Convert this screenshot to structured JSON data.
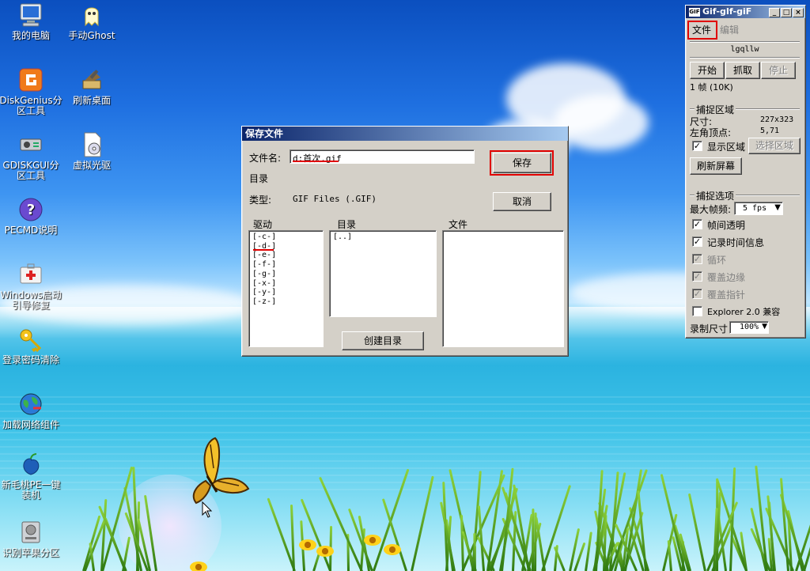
{
  "desktop_icons": [
    {
      "label": "我的电脑",
      "icon": "computer-icon"
    },
    {
      "label": "手动Ghost",
      "icon": "ghost-icon"
    },
    {
      "label": "DiskGenius分区工具",
      "icon": "diskgenius-icon"
    },
    {
      "label": "刷新桌面",
      "icon": "refresh-desktop-icon"
    },
    {
      "label": "GDISKGUI分区工具",
      "icon": "gdisk-icon"
    },
    {
      "label": "虚拟光驱",
      "icon": "virtual-drive-icon"
    },
    {
      "label": "PECMD说明",
      "icon": "help-icon"
    },
    {
      "label": "Windows启动引导修复",
      "icon": "boot-repair-icon"
    },
    {
      "label": "登录密码清除",
      "icon": "key-icon"
    },
    {
      "label": "加载网络组件",
      "icon": "network-icon"
    },
    {
      "label": "新毛桃PE一键装机",
      "icon": "peach-icon"
    },
    {
      "label": "识别苹果分区",
      "icon": "apple-partition-icon"
    }
  ],
  "save_dialog": {
    "title": "保存文件",
    "filename_label": "文件名:",
    "filename_value": "d:首次.gif",
    "dir_label": "目录",
    "type_label": "类型:",
    "type_value": "GIF Files (.GIF)",
    "save_button": "保存",
    "cancel_button": "取消",
    "drives_header": "驱动",
    "dirs_header": "目录",
    "files_header": "文件",
    "drives": [
      "[-c-]",
      "[-d-]",
      "[-e-]",
      "[-f-]",
      "[-g-]",
      "[-x-]",
      "[-y-]",
      "[-z-]"
    ],
    "dirs": [
      "[..]"
    ],
    "files": [],
    "create_dir_button": "创建目录"
  },
  "gif_window": {
    "title": "Gif-gIf-giF",
    "menu": [
      "文件",
      "编辑"
    ],
    "filename": "lgqllw",
    "start_button": "开始",
    "grab_button": "抓取",
    "stop_button": "停止",
    "frame_info": "1 帧 (10K)",
    "capture_area_title": "捕捉区域",
    "size_label": "尺寸:",
    "size_value": "227x323",
    "corner_label": "左角顶点:",
    "corner_value": "5,71",
    "show_area_label": "显示区域",
    "select_area_button": "选择区域",
    "refresh_screen_button": "刷新屏幕",
    "capture_options_title": "捕捉选项",
    "max_fps_label": "最大帧频:",
    "max_fps_value": "5 fps",
    "options": [
      {
        "label": "帧间透明",
        "checked": true,
        "enabled": true
      },
      {
        "label": "记录时间信息",
        "checked": true,
        "enabled": true
      },
      {
        "label": "循环",
        "checked": true,
        "enabled": false
      },
      {
        "label": "覆盖边缘",
        "checked": true,
        "enabled": false
      },
      {
        "label": "覆盖指针",
        "checked": true,
        "enabled": false
      },
      {
        "label": "Explorer 2.0 兼容",
        "checked": false,
        "enabled": true
      }
    ],
    "record_size_label": "录制尺寸",
    "record_size_value": "100%"
  }
}
